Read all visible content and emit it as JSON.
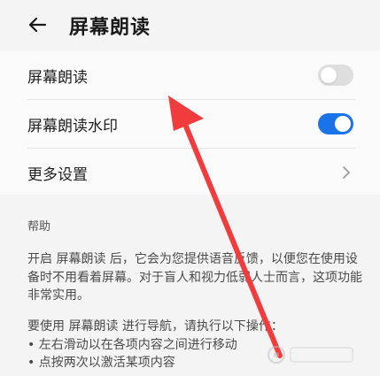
{
  "header": {
    "title": "屏幕朗读",
    "back_icon": "arrow-left-icon"
  },
  "settings": [
    {
      "label": "屏幕朗读",
      "control": "toggle",
      "checked": false
    },
    {
      "label": "屏幕朗读水印",
      "control": "toggle",
      "checked": true
    },
    {
      "label": "更多设置",
      "control": "chevron",
      "icon": "chevron-right-icon"
    }
  ],
  "help": {
    "title": "帮助",
    "paragraph1": "开启 屏幕朗读 后，它会为您提供语音反馈，以便您在使用设备时不用看着屏幕。对于盲人和视力低弱人士而言，这项功能非常实用。",
    "paragraph2_intro": "要使用 屏幕朗读 进行导航，请执行以下操作：",
    "bullets": [
      "• 左右滑动以在各项内容之间进行移动",
      "• 点按两次以激活某项内容"
    ]
  },
  "overlay": {
    "annotation_arrow_color": "#f03c3c"
  },
  "colors": {
    "toggle_on": "#1a73e8",
    "toggle_off": "#dedede"
  }
}
